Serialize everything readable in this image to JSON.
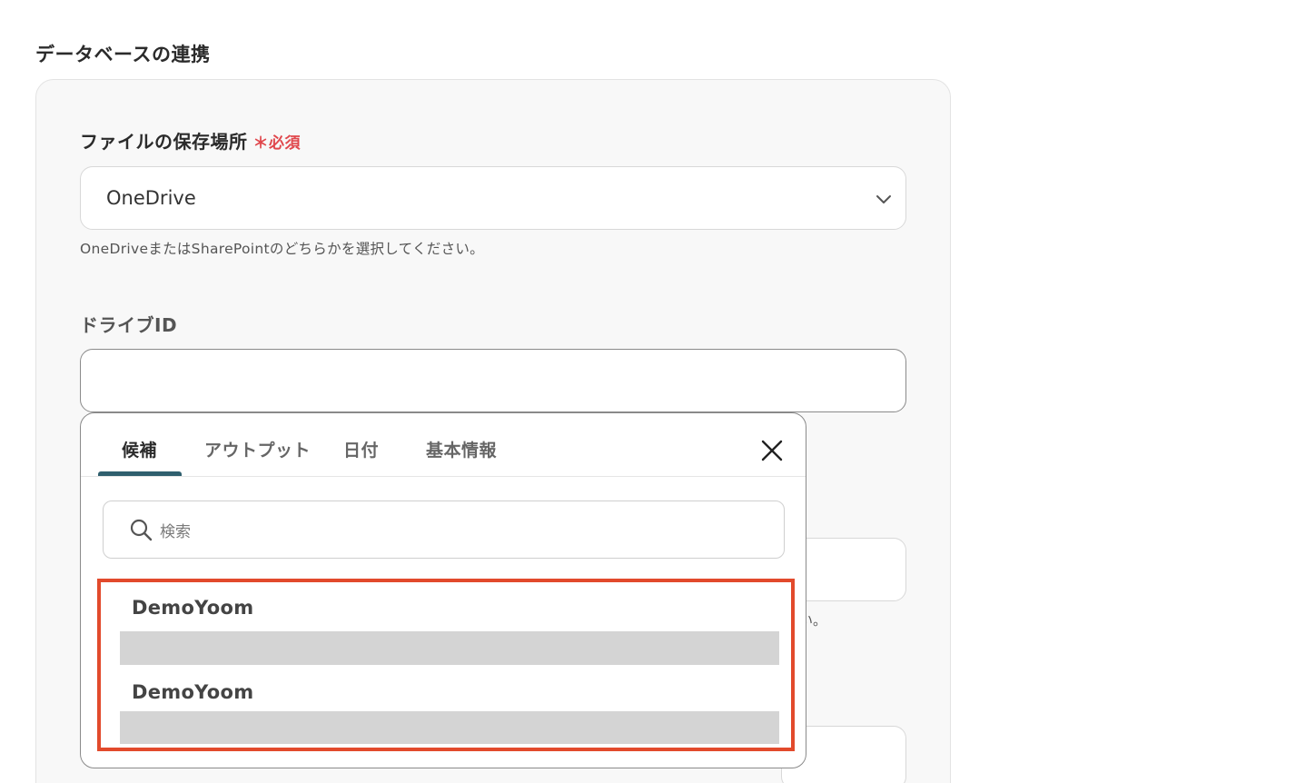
{
  "section": {
    "title": "データベースの連携"
  },
  "storage": {
    "label": "ファイルの保存場所",
    "required_mark": "＊",
    "required_text": "必須",
    "selected_value": "OneDrive",
    "helper": "OneDriveまたはSharePointのどちらかを選択してください。"
  },
  "drive": {
    "label": "ドライブID",
    "value": ""
  },
  "background": {
    "helper_tail": "い。"
  },
  "popup": {
    "tabs": [
      {
        "label": "候補"
      },
      {
        "label": "アウトプット"
      },
      {
        "label": "日付"
      },
      {
        "label": "基本情報"
      }
    ],
    "search_placeholder": "検索",
    "items": [
      {
        "title": "DemoYoom"
      },
      {
        "title": "DemoYoom"
      }
    ]
  },
  "colors": {
    "required": "#e0474c",
    "tab_underline": "#2f5f6e",
    "highlight": "#e24a2c",
    "redaction": "#d4d4d4"
  }
}
